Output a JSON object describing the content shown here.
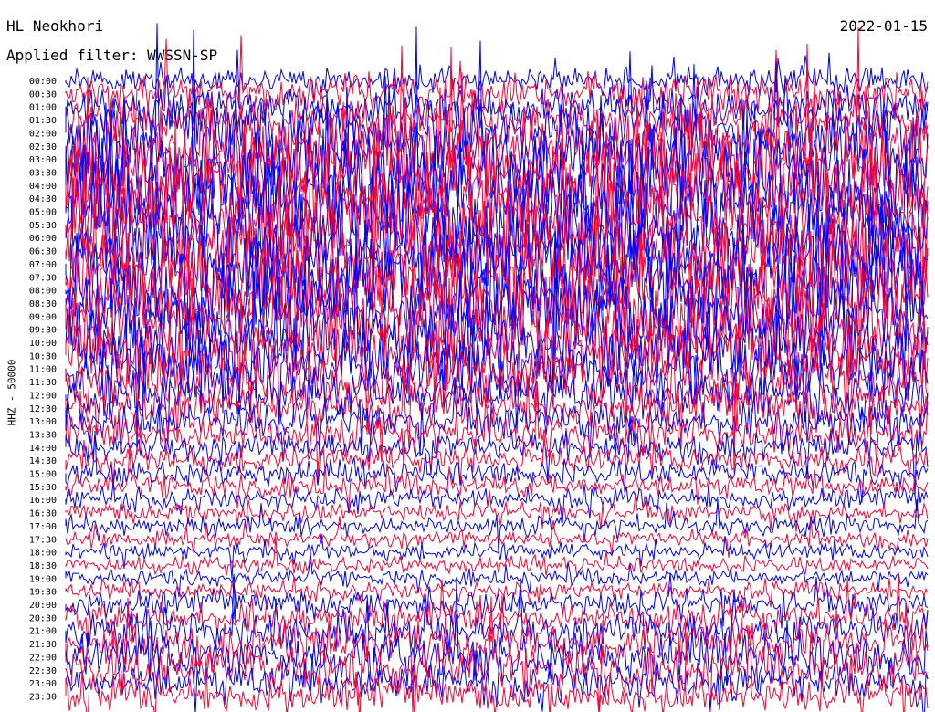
{
  "header": {
    "station": "HL Neokhori",
    "date": "2022-01-15",
    "filter_label": "Applied filter: WWSSN-SP"
  },
  "chart_data": {
    "type": "line",
    "title": "HL Neokhori",
    "ylabel": "HHZ - 50000",
    "colors": [
      "#0000ff",
      "#ff0033"
    ],
    "row_labels": [
      "00:00",
      "00:30",
      "01:00",
      "01:30",
      "02:00",
      "02:30",
      "03:00",
      "03:30",
      "04:00",
      "04:30",
      "05:00",
      "05:30",
      "06:00",
      "06:30",
      "07:00",
      "07:30",
      "08:00",
      "08:30",
      "09:00",
      "09:30",
      "10:00",
      "10:30",
      "11:00",
      "11:30",
      "12:00",
      "12:30",
      "13:00",
      "13:30",
      "14:00",
      "14:30",
      "15:00",
      "15:30",
      "16:00",
      "16:30",
      "17:00",
      "17:30",
      "18:00",
      "18:30",
      "19:00",
      "19:30",
      "20:00",
      "20:30",
      "21:00",
      "21:30",
      "22:00",
      "22:30",
      "23:00",
      "23:30"
    ],
    "row_activity": [
      0.25,
      0.35,
      0.4,
      0.45,
      0.75,
      0.9,
      1.0,
      1.0,
      1.0,
      1.0,
      1.0,
      1.0,
      1.0,
      1.0,
      1.0,
      1.0,
      1.0,
      1.0,
      0.95,
      0.9,
      0.85,
      0.8,
      0.7,
      0.6,
      0.5,
      0.45,
      0.4,
      0.35,
      0.3,
      0.25,
      0.22,
      0.2,
      0.18,
      0.16,
      0.15,
      0.14,
      0.13,
      0.12,
      0.12,
      0.14,
      0.25,
      0.3,
      0.4,
      0.45,
      0.45,
      0.45,
      0.4,
      0.35
    ],
    "grid": false
  }
}
